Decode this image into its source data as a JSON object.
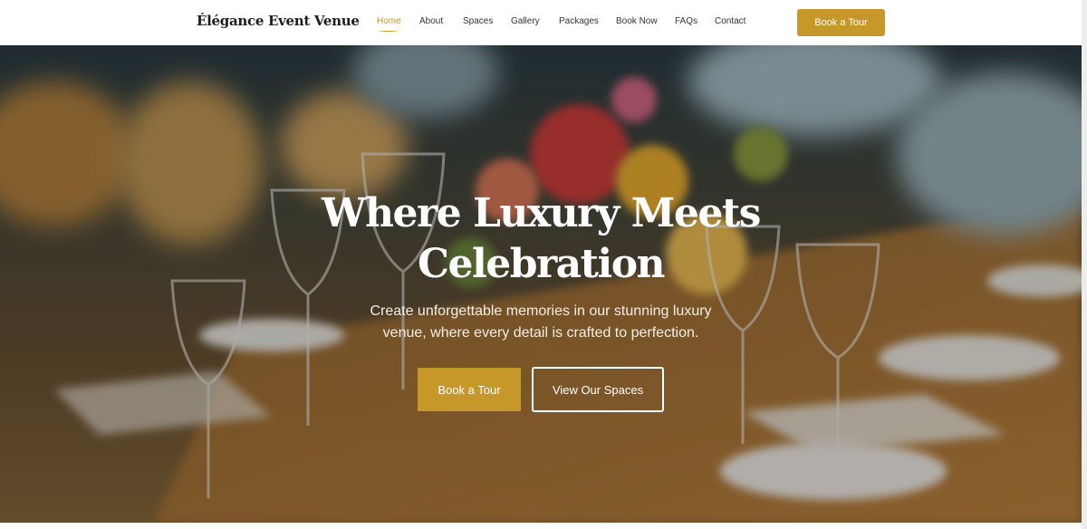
{
  "brand": {
    "name": "Élégance Event Venue"
  },
  "nav": {
    "items": [
      {
        "label": "Home",
        "active": true
      },
      {
        "label": "About"
      },
      {
        "label": "Spaces"
      },
      {
        "label": "Gallery"
      },
      {
        "label": "Packages"
      },
      {
        "label": "Book Now"
      },
      {
        "label": "FAQs"
      },
      {
        "label": "Contact"
      }
    ],
    "cta_label": "Book a Tour"
  },
  "hero": {
    "title": "Where Luxury Meets Celebration",
    "subtitle": "Create unforgettable memories in our stunning luxury venue, where every detail is crafted to perfection.",
    "primary_button": "Book a Tour",
    "secondary_button": "View Our Spaces",
    "background_image": "banquet-table-image"
  },
  "colors": {
    "accent": "#c6982a",
    "nav_text": "#333333",
    "brand_text": "#1d1d1d",
    "hero_text": "#ffffff"
  }
}
